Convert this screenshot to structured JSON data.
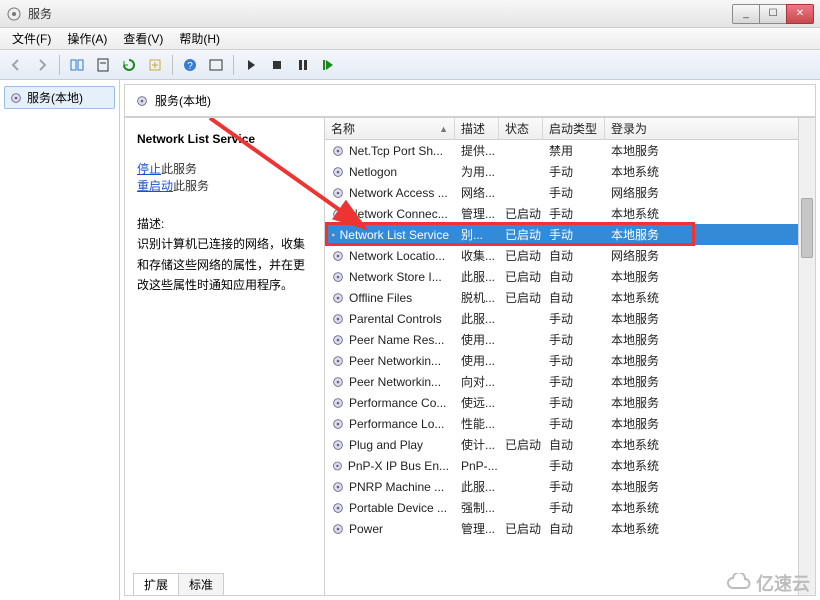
{
  "window": {
    "title": "服务",
    "min": "_",
    "max": "☐",
    "close": "✕"
  },
  "menu": {
    "file": "文件(F)",
    "action": "操作(A)",
    "view": "查看(V)",
    "help": "帮助(H)"
  },
  "tree": {
    "root_label": "服务(本地)"
  },
  "content_header": "服务(本地)",
  "detail": {
    "selected_title": "Network List Service",
    "stop_link": "停止",
    "stop_tail": "此服务",
    "restart_link": "重启动",
    "restart_tail": "此服务",
    "desc_label": "描述:",
    "desc_body": "识别计算机已连接的网络，收集和存储这些网络的属性，并在更改这些属性时通知应用程序。"
  },
  "columns": {
    "name": "名称",
    "desc": "描述",
    "status": "状态",
    "startup": "启动类型",
    "logon": "登录为"
  },
  "rows": [
    {
      "name": "Net.Tcp Port Sh...",
      "desc": "提供...",
      "status": "",
      "startup": "禁用",
      "logon": "本地服务",
      "selected": false
    },
    {
      "name": "Netlogon",
      "desc": "为用...",
      "status": "",
      "startup": "手动",
      "logon": "本地系统",
      "selected": false
    },
    {
      "name": "Network Access ...",
      "desc": "网络...",
      "status": "",
      "startup": "手动",
      "logon": "网络服务",
      "selected": false
    },
    {
      "name": "Network Connec...",
      "desc": "管理...",
      "status": "已启动",
      "startup": "手动",
      "logon": "本地系统",
      "selected": false
    },
    {
      "name": "Network List Service",
      "desc": "别...",
      "status": "已启动",
      "startup": "手动",
      "logon": "本地服务",
      "selected": true
    },
    {
      "name": "Network Locatio...",
      "desc": "收集...",
      "status": "已启动",
      "startup": "自动",
      "logon": "网络服务",
      "selected": false
    },
    {
      "name": "Network Store I...",
      "desc": "此服...",
      "status": "已启动",
      "startup": "自动",
      "logon": "本地服务",
      "selected": false
    },
    {
      "name": "Offline Files",
      "desc": "脱机...",
      "status": "已启动",
      "startup": "自动",
      "logon": "本地系统",
      "selected": false
    },
    {
      "name": "Parental Controls",
      "desc": "此服...",
      "status": "",
      "startup": "手动",
      "logon": "本地服务",
      "selected": false
    },
    {
      "name": "Peer Name Res...",
      "desc": "使用...",
      "status": "",
      "startup": "手动",
      "logon": "本地服务",
      "selected": false
    },
    {
      "name": "Peer Networkin...",
      "desc": "使用...",
      "status": "",
      "startup": "手动",
      "logon": "本地服务",
      "selected": false
    },
    {
      "name": "Peer Networkin...",
      "desc": "向对...",
      "status": "",
      "startup": "手动",
      "logon": "本地服务",
      "selected": false
    },
    {
      "name": "Performance Co...",
      "desc": "使远...",
      "status": "",
      "startup": "手动",
      "logon": "本地服务",
      "selected": false
    },
    {
      "name": "Performance Lo...",
      "desc": "性能...",
      "status": "",
      "startup": "手动",
      "logon": "本地服务",
      "selected": false
    },
    {
      "name": "Plug and Play",
      "desc": "使计...",
      "status": "已启动",
      "startup": "自动",
      "logon": "本地系统",
      "selected": false
    },
    {
      "name": "PnP-X IP Bus En...",
      "desc": "PnP-...",
      "status": "",
      "startup": "手动",
      "logon": "本地系统",
      "selected": false
    },
    {
      "name": "PNRP Machine ...",
      "desc": "此服...",
      "status": "",
      "startup": "手动",
      "logon": "本地服务",
      "selected": false
    },
    {
      "name": "Portable Device ...",
      "desc": "强制...",
      "status": "",
      "startup": "手动",
      "logon": "本地系统",
      "selected": false
    },
    {
      "name": "Power",
      "desc": "管理...",
      "status": "已启动",
      "startup": "自动",
      "logon": "本地系统",
      "selected": false
    }
  ],
  "tabs": {
    "extended": "扩展",
    "standard": "标准"
  },
  "watermark": "亿速云",
  "colors": {
    "select_bg": "#338ad6",
    "highlight": "#e33"
  }
}
